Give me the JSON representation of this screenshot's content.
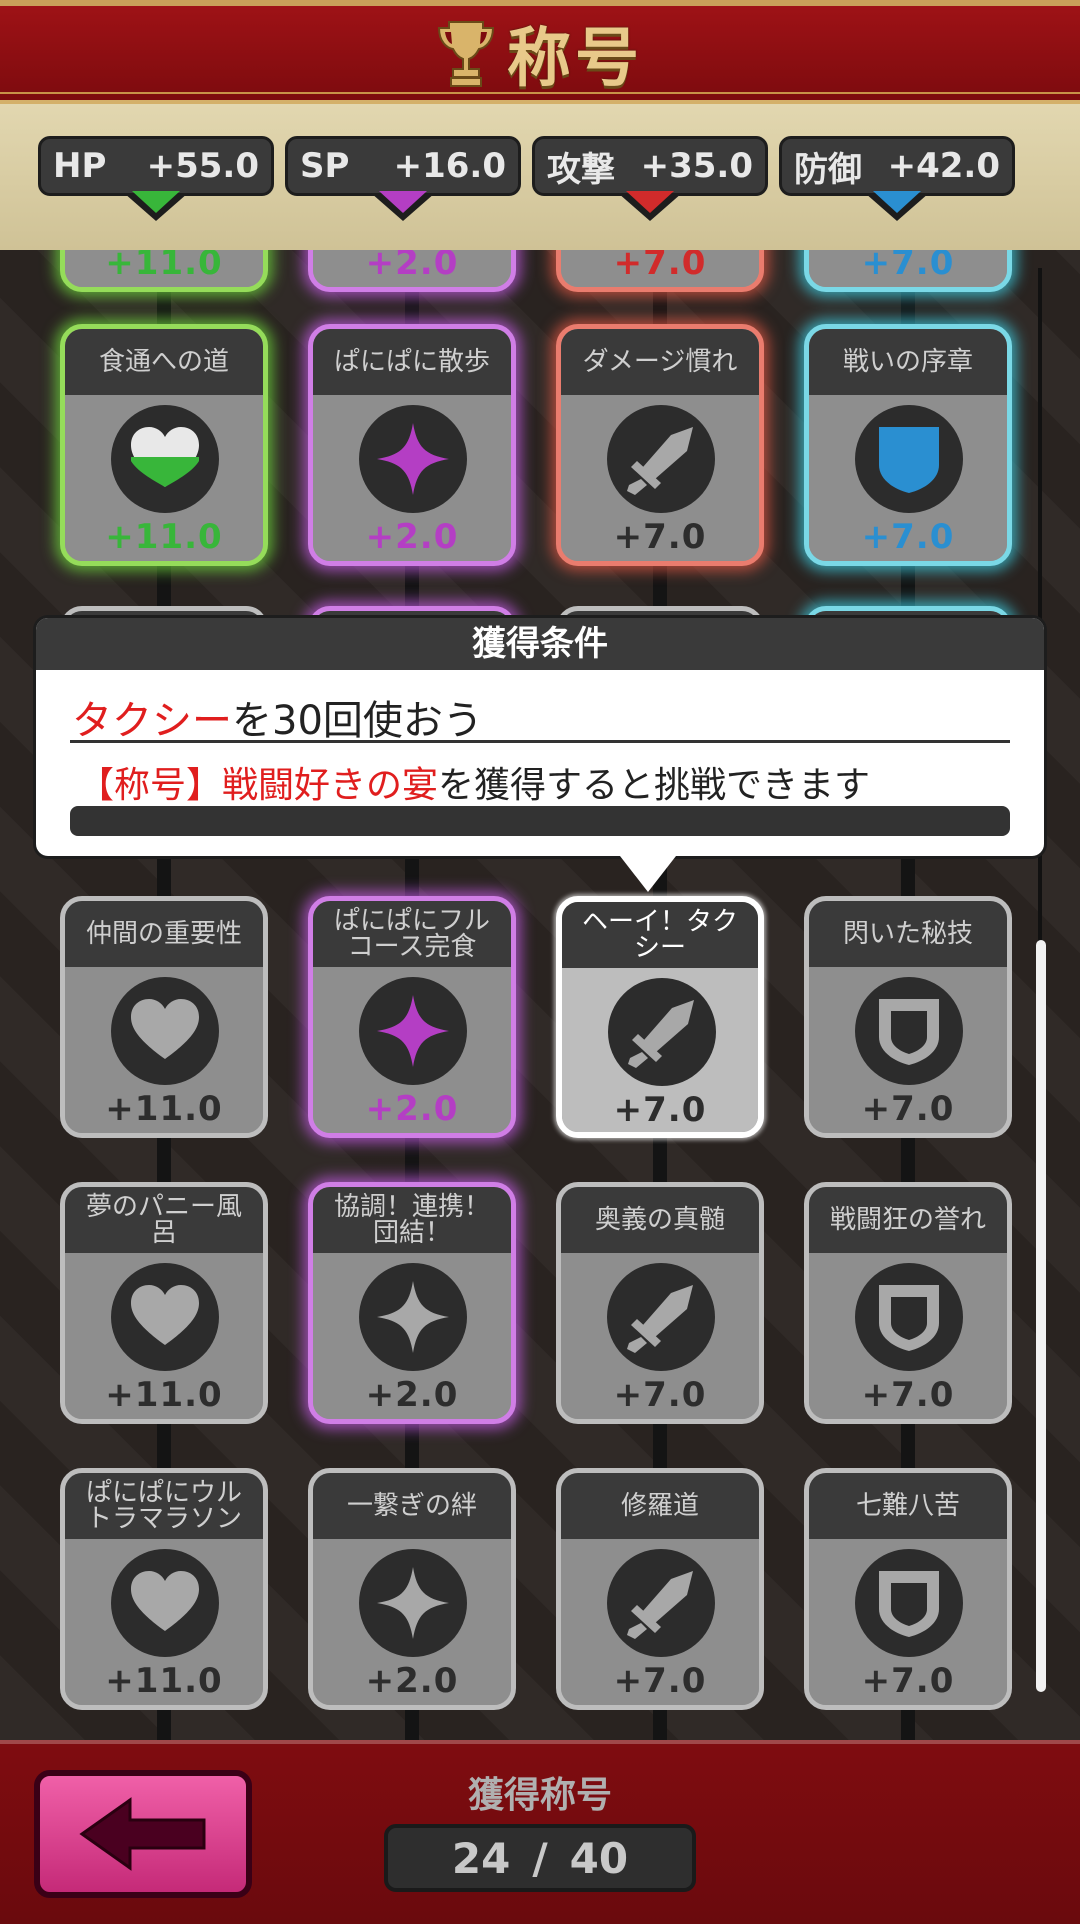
{
  "header": {
    "title": "称号"
  },
  "stats": [
    {
      "label": "HP",
      "value": "+55.0",
      "color": "#38b63a"
    },
    {
      "label": "SP",
      "value": "+16.0",
      "color": "#b43ec4"
    },
    {
      "label": "攻撃",
      "value": "+35.0",
      "color": "#d12b2b"
    },
    {
      "label": "防御",
      "value": "+42.0",
      "color": "#2a8fd1"
    }
  ],
  "partial_row": [
    "+11.0",
    "+2.0",
    "+7.0",
    "+7.0"
  ],
  "cards": [
    {
      "title": "食通への道",
      "value": "+11.0",
      "type": "heart",
      "state": "unlocked"
    },
    {
      "title": "ぱにぱに散歩",
      "value": "+2.0",
      "type": "star",
      "state": "unlocked"
    },
    {
      "title": "ダメージ慣れ",
      "value": "+7.0",
      "type": "sword",
      "state": "unlocked"
    },
    {
      "title": "戦いの序章",
      "value": "+7.0",
      "type": "shield",
      "state": "unlocked"
    },
    {
      "title": "仲間の重要性",
      "value": "+11.0",
      "type": "heart",
      "state": "locked"
    },
    {
      "title": "ぱにぱにフル\nコース完食",
      "value": "+2.0",
      "type": "star",
      "state": "unlocked"
    },
    {
      "title": "ヘーイ！タク\nシー",
      "value": "+7.0",
      "type": "sword",
      "state": "selected"
    },
    {
      "title": "閃いた秘技",
      "value": "+7.0",
      "type": "shield",
      "state": "locked"
    },
    {
      "title": "夢のパニー風\n呂",
      "value": "+11.0",
      "type": "heart",
      "state": "locked"
    },
    {
      "title": "協調！連携！\n団結！",
      "value": "+2.0",
      "type": "star",
      "state": "glow-locked"
    },
    {
      "title": "奥義の真髄",
      "value": "+7.0",
      "type": "sword",
      "state": "locked"
    },
    {
      "title": "戦闘狂の誉れ",
      "value": "+7.0",
      "type": "shield",
      "state": "locked"
    },
    {
      "title": "ぱにぱにウル\nトラマラソン",
      "value": "+11.0",
      "type": "heart",
      "state": "locked"
    },
    {
      "title": "一繋ぎの絆",
      "value": "+2.0",
      "type": "star",
      "state": "locked"
    },
    {
      "title": "修羅道",
      "value": "+7.0",
      "type": "sword",
      "state": "locked"
    },
    {
      "title": "七難八苦",
      "value": "+7.0",
      "type": "shield",
      "state": "locked"
    }
  ],
  "popup": {
    "header": "獲得条件",
    "line1_highlight": "タクシー",
    "line1_rest": "を30回使おう",
    "line2_prefix": "【称号】",
    "line2_highlight": "戦闘好きの宴",
    "line2_rest": "を獲得すると挑戦できます"
  },
  "footer": {
    "label": "獲得称号",
    "count": "24",
    "separator": "/",
    "total": "40"
  },
  "icons": {
    "header": "trophy-icon",
    "back": "back-arrow-icon",
    "hp": "heart-icon",
    "sp": "star-icon",
    "attack": "sword-icon",
    "defense": "shield-icon"
  },
  "colors": {
    "hp": "#38b63a",
    "sp": "#b43ec4",
    "attack": "#d12b2b",
    "defense": "#2a8fd1",
    "locked_icon": "#a8a8a8",
    "accent_red": "#e01e1e"
  }
}
